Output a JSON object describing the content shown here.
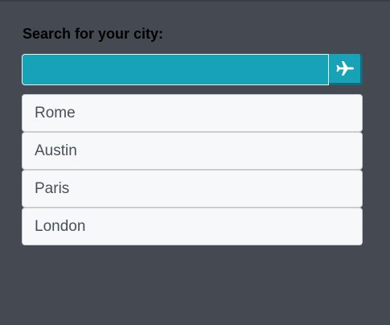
{
  "search": {
    "heading": "Search for your city:",
    "value": "",
    "placeholder": "",
    "button_icon": "airplane-icon"
  },
  "cities": [
    {
      "label": "Rome"
    },
    {
      "label": "Austin"
    },
    {
      "label": "Paris"
    },
    {
      "label": "London"
    }
  ],
  "colors": {
    "background": "#454a52",
    "accent": "#17a2b8",
    "list_item_bg": "#f7f8fa",
    "list_text": "#495057"
  }
}
